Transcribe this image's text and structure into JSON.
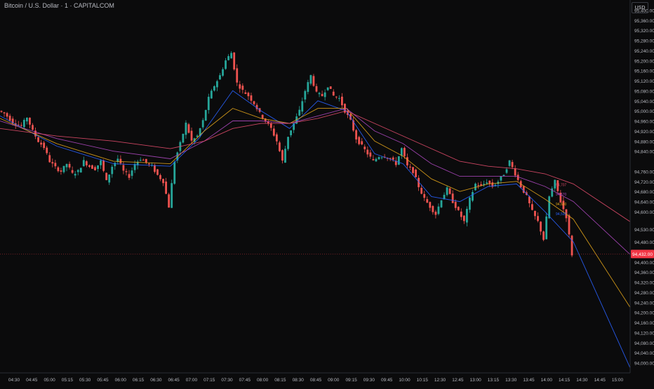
{
  "header": {
    "title": "Bitcoin / U.S. Dollar · 1 · CAPITALCOM",
    "currency": "USD"
  },
  "colors": {
    "background": "#0b0b0c",
    "up": "#26a69a",
    "down": "#ef5350",
    "ema_fast": "#2962ff",
    "ema_mid": "#e0a31a",
    "ema_slow": "#ab47bc",
    "ema_long": "#e04b6a",
    "last_price": "#f23645"
  },
  "chart_data": {
    "type": "candlestick",
    "title": "Bitcoin / U.S. Dollar · 1 · CAPITALCOM",
    "ylim": [
      93960,
      95440
    ],
    "y_ticks": [
      "95,400.00",
      "95,360.00",
      "95,320.00",
      "95,280.00",
      "95,240.00",
      "95,200.00",
      "95,160.00",
      "95,120.00",
      "95,080.00",
      "95,040.00",
      "95,000.00",
      "94,960.00",
      "94,920.00",
      "94,880.00",
      "94,840.00",
      "94,760.00",
      "94,720.00",
      "94,680.00",
      "94,640.00",
      "94,600.00",
      "94,530.00",
      "94,480.00",
      "94,400.00",
      "94,360.00",
      "94,320.00",
      "94,280.00",
      "94,240.00",
      "94,200.00",
      "94,160.00",
      "94,120.00",
      "94,080.00",
      "94,040.00",
      "94,000.00"
    ],
    "x_ticks": [
      "04:30",
      "04:45",
      "05:00",
      "05:15",
      "05:30",
      "05:45",
      "06:00",
      "06:15",
      "06:30",
      "06:45",
      "07:00",
      "07:15",
      "07:30",
      "07:45",
      "08:00",
      "08:15",
      "08:30",
      "08:45",
      "09:00",
      "09:15",
      "09:30",
      "09:45",
      "10:00",
      "10:15",
      "12:30",
      "12:45",
      "13:00",
      "13:15",
      "13:30",
      "13:45",
      "14:00",
      "14:15",
      "14:30",
      "14:45",
      "15:00"
    ],
    "last_price": {
      "value": 94432.0,
      "label": "94,432.00"
    },
    "price_path": [
      [
        0,
        95000
      ],
      [
        2,
        94990
      ],
      [
        5,
        94955
      ],
      [
        8,
        94940
      ],
      [
        10,
        94975
      ],
      [
        12,
        94920
      ],
      [
        14,
        94880
      ],
      [
        16,
        94855
      ],
      [
        18,
        94800
      ],
      [
        20,
        94775
      ],
      [
        22,
        94760
      ],
      [
        24,
        94790
      ],
      [
        26,
        94750
      ],
      [
        28,
        94760
      ],
      [
        30,
        94800
      ],
      [
        32,
        94780
      ],
      [
        34,
        94770
      ],
      [
        36,
        94800
      ],
      [
        38,
        94720
      ],
      [
        40,
        94780
      ],
      [
        42,
        94810
      ],
      [
        44,
        94760
      ],
      [
        46,
        94740
      ],
      [
        48,
        94790
      ],
      [
        50,
        94810
      ],
      [
        52,
        94795
      ],
      [
        54,
        94780
      ],
      [
        56,
        94745
      ],
      [
        58,
        94720
      ],
      [
        60,
        94620
      ],
      [
        62,
        94800
      ],
      [
        64,
        94870
      ],
      [
        66,
        94950
      ],
      [
        68,
        94880
      ],
      [
        70,
        94900
      ],
      [
        72,
        94960
      ],
      [
        74,
        95050
      ],
      [
        76,
        95100
      ],
      [
        78,
        95140
      ],
      [
        80,
        95200
      ],
      [
        82,
        95230
      ],
      [
        84,
        95110
      ],
      [
        86,
        95080
      ],
      [
        88,
        95060
      ],
      [
        90,
        95030
      ],
      [
        92,
        94990
      ],
      [
        94,
        94960
      ],
      [
        96,
        94930
      ],
      [
        98,
        94880
      ],
      [
        100,
        94800
      ],
      [
        102,
        94900
      ],
      [
        104,
        94950
      ],
      [
        106,
        95000
      ],
      [
        108,
        95080
      ],
      [
        110,
        95140
      ],
      [
        112,
        95070
      ],
      [
        114,
        95060
      ],
      [
        116,
        95100
      ],
      [
        118,
        95060
      ],
      [
        120,
        95050
      ],
      [
        122,
        95000
      ],
      [
        124,
        94960
      ],
      [
        126,
        94890
      ],
      [
        128,
        94860
      ],
      [
        130,
        94830
      ],
      [
        132,
        94800
      ],
      [
        134,
        94820
      ],
      [
        136,
        94820
      ],
      [
        138,
        94810
      ],
      [
        140,
        94790
      ],
      [
        142,
        94850
      ],
      [
        144,
        94780
      ],
      [
        146,
        94760
      ],
      [
        148,
        94700
      ],
      [
        150,
        94650
      ],
      [
        152,
        94620
      ],
      [
        154,
        94590
      ],
      [
        156,
        94650
      ],
      [
        158,
        94690
      ],
      [
        160,
        94640
      ],
      [
        162,
        94600
      ],
      [
        164,
        94560
      ],
      [
        166,
        94650
      ],
      [
        168,
        94710
      ],
      [
        170,
        94700
      ],
      [
        172,
        94720
      ],
      [
        174,
        94700
      ],
      [
        176,
        94720
      ],
      [
        178,
        94750
      ],
      [
        180,
        94800
      ],
      [
        182,
        94750
      ],
      [
        184,
        94700
      ],
      [
        186,
        94660
      ],
      [
        188,
        94600
      ],
      [
        190,
        94560
      ],
      [
        192,
        94490
      ],
      [
        194,
        94660
      ],
      [
        196,
        94720
      ],
      [
        198,
        94640
      ],
      [
        200,
        94580
      ],
      [
        202,
        94430
      ]
    ],
    "series": [
      {
        "values": [
          [
            0,
            94980
          ],
          [
            20,
            94860
          ],
          [
            40,
            94790
          ],
          [
            60,
            94780
          ],
          [
            70,
            94890
          ],
          [
            82,
            95080
          ],
          [
            92,
            95000
          ],
          [
            102,
            94930
          ],
          [
            112,
            95040
          ],
          [
            122,
            95000
          ],
          [
            132,
            94830
          ],
          [
            142,
            94790
          ],
          [
            152,
            94660
          ],
          [
            162,
            94640
          ],
          [
            172,
            94700
          ],
          [
            182,
            94710
          ],
          [
            192,
            94600
          ],
          [
            202,
            94480
          ],
          [
            222,
            93980
          ]
        ]
      },
      {
        "values": [
          [
            0,
            94970
          ],
          [
            20,
            94870
          ],
          [
            40,
            94800
          ],
          [
            60,
            94790
          ],
          [
            72,
            94920
          ],
          [
            82,
            95010
          ],
          [
            92,
            94970
          ],
          [
            102,
            94950
          ],
          [
            112,
            95010
          ],
          [
            122,
            95010
          ],
          [
            132,
            94880
          ],
          [
            142,
            94820
          ],
          [
            152,
            94730
          ],
          [
            162,
            94680
          ],
          [
            172,
            94710
          ],
          [
            182,
            94720
          ],
          [
            192,
            94650
          ],
          [
            202,
            94570
          ],
          [
            222,
            94220
          ]
        ]
      },
      {
        "values": [
          [
            0,
            94960
          ],
          [
            20,
            94890
          ],
          [
            40,
            94840
          ],
          [
            60,
            94810
          ],
          [
            72,
            94880
          ],
          [
            82,
            94960
          ],
          [
            92,
            94960
          ],
          [
            102,
            94950
          ],
          [
            112,
            94980
          ],
          [
            122,
            95010
          ],
          [
            132,
            94920
          ],
          [
            142,
            94870
          ],
          [
            152,
            94790
          ],
          [
            162,
            94740
          ],
          [
            172,
            94740
          ],
          [
            182,
            94740
          ],
          [
            192,
            94700
          ],
          [
            202,
            94640
          ],
          [
            222,
            94430
          ]
        ]
      },
      {
        "values": [
          [
            0,
            94930
          ],
          [
            20,
            94900
          ],
          [
            40,
            94880
          ],
          [
            60,
            94850
          ],
          [
            72,
            94880
          ],
          [
            82,
            94930
          ],
          [
            92,
            94950
          ],
          [
            102,
            94950
          ],
          [
            112,
            94970
          ],
          [
            122,
            95000
          ],
          [
            132,
            94950
          ],
          [
            142,
            94900
          ],
          [
            152,
            94850
          ],
          [
            162,
            94800
          ],
          [
            172,
            94780
          ],
          [
            182,
            94770
          ],
          [
            192,
            94750
          ],
          [
            202,
            94710
          ],
          [
            222,
            94560
          ]
        ]
      }
    ],
    "ema_labels": [
      {
        "text": "94,707",
        "value": 94707,
        "color": "#e04b6a"
      },
      {
        "text": "94,670",
        "value": 94670,
        "color": "#ab47bc"
      },
      {
        "text": "94,630",
        "value": 94630,
        "color": "#e0a31a"
      },
      {
        "text": "94,592",
        "value": 94592,
        "color": "#2962ff"
      }
    ]
  }
}
